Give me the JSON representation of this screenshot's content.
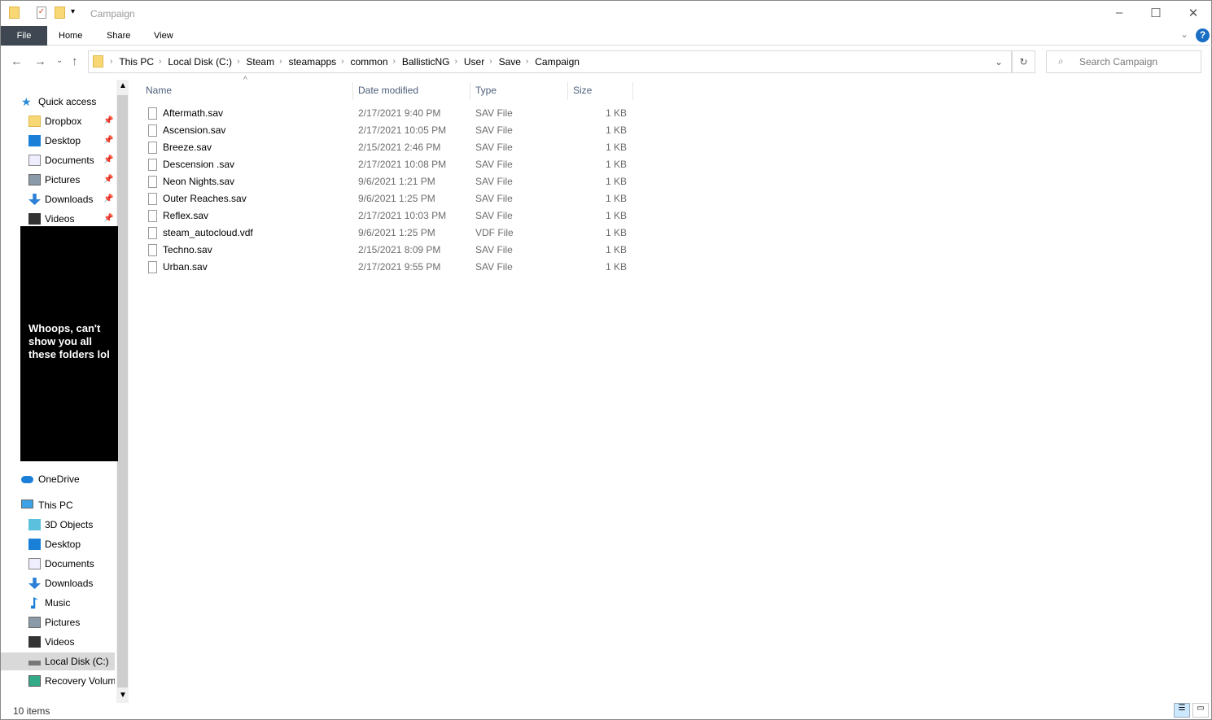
{
  "window": {
    "title": "Campaign",
    "minimize": "–",
    "maximize": "☐",
    "close": "✕"
  },
  "ribbon": {
    "tabs": [
      "File",
      "Home",
      "Share",
      "View"
    ],
    "help": "?",
    "expand": "⌄"
  },
  "nav": {
    "back": "←",
    "forward": "→",
    "recent": "⌄",
    "up": "↑"
  },
  "address": {
    "crumbs": [
      "This PC",
      "Local Disk (C:)",
      "Steam",
      "steamapps",
      "common",
      "BallisticNG",
      "User",
      "Save",
      "Campaign"
    ],
    "dropdown": "⌄",
    "refresh": "↻"
  },
  "search": {
    "placeholder": "Search Campaign"
  },
  "sidebar": {
    "quick_access": "Quick access",
    "pinned": [
      {
        "label": "Dropbox",
        "icon": "folder"
      },
      {
        "label": "Desktop",
        "icon": "desktop"
      },
      {
        "label": "Documents",
        "icon": "documents"
      },
      {
        "label": "Pictures",
        "icon": "pictures"
      },
      {
        "label": "Downloads",
        "icon": "downloads"
      },
      {
        "label": "Videos",
        "icon": "videos"
      }
    ],
    "redaction": "Whoops, can't show you all these folders lol",
    "onedrive": "OneDrive",
    "this_pc": "This PC",
    "pc_items": [
      {
        "label": "3D Objects",
        "icon": "3d"
      },
      {
        "label": "Desktop",
        "icon": "desktop"
      },
      {
        "label": "Documents",
        "icon": "documents"
      },
      {
        "label": "Downloads",
        "icon": "downloads"
      },
      {
        "label": "Music",
        "icon": "music"
      },
      {
        "label": "Pictures",
        "icon": "pictures"
      },
      {
        "label": "Videos",
        "icon": "videos"
      },
      {
        "label": "Local Disk (C:)",
        "icon": "disk"
      },
      {
        "label": "Recovery Volum",
        "icon": "recovery"
      }
    ]
  },
  "columns": {
    "name": "Name",
    "date": "Date modified",
    "type": "Type",
    "size": "Size"
  },
  "files": [
    {
      "name": "Aftermath.sav",
      "date": "2/17/2021 9:40 PM",
      "type": "SAV File",
      "size": "1 KB"
    },
    {
      "name": "Ascension.sav",
      "date": "2/17/2021 10:05 PM",
      "type": "SAV File",
      "size": "1 KB"
    },
    {
      "name": "Breeze.sav",
      "date": "2/15/2021 2:46 PM",
      "type": "SAV File",
      "size": "1 KB"
    },
    {
      "name": "Descension .sav",
      "date": "2/17/2021 10:08 PM",
      "type": "SAV File",
      "size": "1 KB"
    },
    {
      "name": "Neon Nights.sav",
      "date": "9/6/2021 1:21 PM",
      "type": "SAV File",
      "size": "1 KB"
    },
    {
      "name": "Outer Reaches.sav",
      "date": "9/6/2021 1:25 PM",
      "type": "SAV File",
      "size": "1 KB"
    },
    {
      "name": "Reflex.sav",
      "date": "2/17/2021 10:03 PM",
      "type": "SAV File",
      "size": "1 KB"
    },
    {
      "name": "steam_autocloud.vdf",
      "date": "9/6/2021 1:25 PM",
      "type": "VDF File",
      "size": "1 KB"
    },
    {
      "name": "Techno.sav",
      "date": "2/15/2021 8:09 PM",
      "type": "SAV File",
      "size": "1 KB"
    },
    {
      "name": "Urban.sav",
      "date": "2/17/2021 9:55 PM",
      "type": "SAV File",
      "size": "1 KB"
    }
  ],
  "status": {
    "count": "10 items"
  }
}
